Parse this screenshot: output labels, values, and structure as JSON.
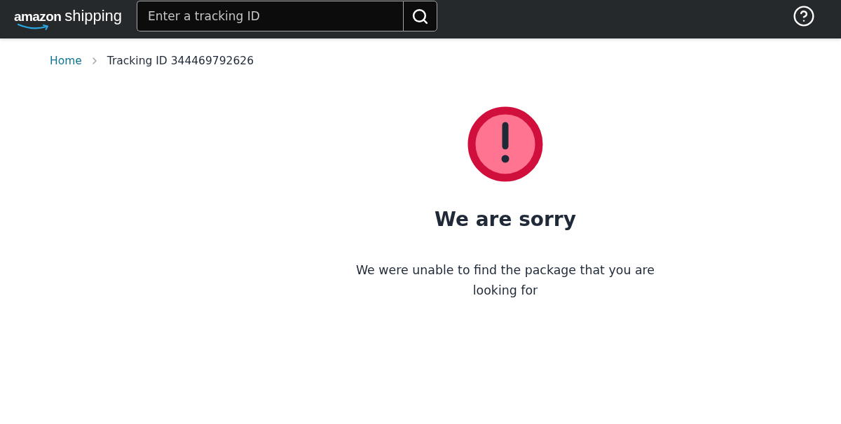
{
  "header": {
    "logo": {
      "brand": "amazon",
      "product": "shipping"
    },
    "search": {
      "placeholder": "Enter a tracking ID"
    }
  },
  "breadcrumb": [
    {
      "label": "Home",
      "kind": "link"
    },
    {
      "label": "Tracking ID 344469792626",
      "kind": "current"
    }
  ],
  "message": {
    "title": "We are sorry",
    "body": "We were unable to find the package that you are looking for"
  }
}
